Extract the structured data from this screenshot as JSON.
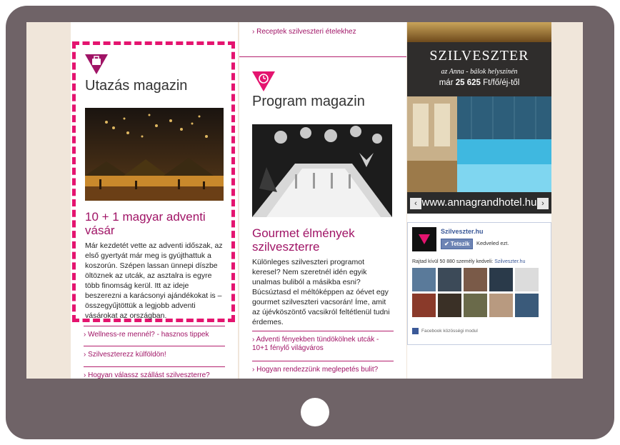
{
  "col1": {
    "magazine_title": "Utazás magazin",
    "article_title": "10 + 1 magyar adventi vásár",
    "article_text": "Már kezdetét vette az adventi időszak, az első gyertyát már meg is gyújthattuk a koszorún. Szépen lassan ünnepi díszbe öltöznek az utcák, az asztalra is egyre több finomság kerül. Itt az ideje beszerezni a karácsonyi ajándékokat is – összegyűjtöttük a legjobb adventi vásárokat az országban.",
    "links": [
      "Wellness-re mennél? - hasznos tippek",
      "Szilveszterezz külföldön!",
      "Hogyan válassz szállást szilveszterre?"
    ]
  },
  "col2": {
    "top_link": "Receptek szilveszteri ételekhez",
    "magazine_title": "Program magazin",
    "article_title": "Gourmet élmények szilveszterre",
    "article_text": "Különleges szilveszteri programot keresel? Nem szeretnél idén egyik unalmas buliból a másikba esni? Búcsúztasd el méltóképpen az óévet egy gourmet szilveszteri vacsorán! Íme, amit az újévköszöntő vacsikról feltétlenül tudni érdemes.",
    "links": [
      "Adventi fényekben tündökölnek utcák - 10+1 fénylő világváros",
      "Hogyan rendezzünk meglepetés bulit?"
    ]
  },
  "ad": {
    "title": "SZILVESZTER",
    "subtitle": "az Anna - bálok helyszínén",
    "price_prefix": "már",
    "price_value": "25 625",
    "price_suffix": "Ft/fő/éj-től",
    "url": "www.annagrandhotel.hu",
    "prev_arrow": "‹",
    "next_arrow": "›"
  },
  "facebook": {
    "page_name": "Szilveszter.hu",
    "like_button": "✔ Tetszik",
    "like_text": "Kedveled ezt.",
    "count_text": "Rajtad kívül 50 880 személy kedveli:",
    "count_link": "Szilveszter.hu",
    "footer": "Facebook közösségi modul"
  },
  "colors": {
    "accent": "#e4146f",
    "link": "#a01466",
    "frame": "#6f6367",
    "screen_bg": "#f0e6da"
  }
}
